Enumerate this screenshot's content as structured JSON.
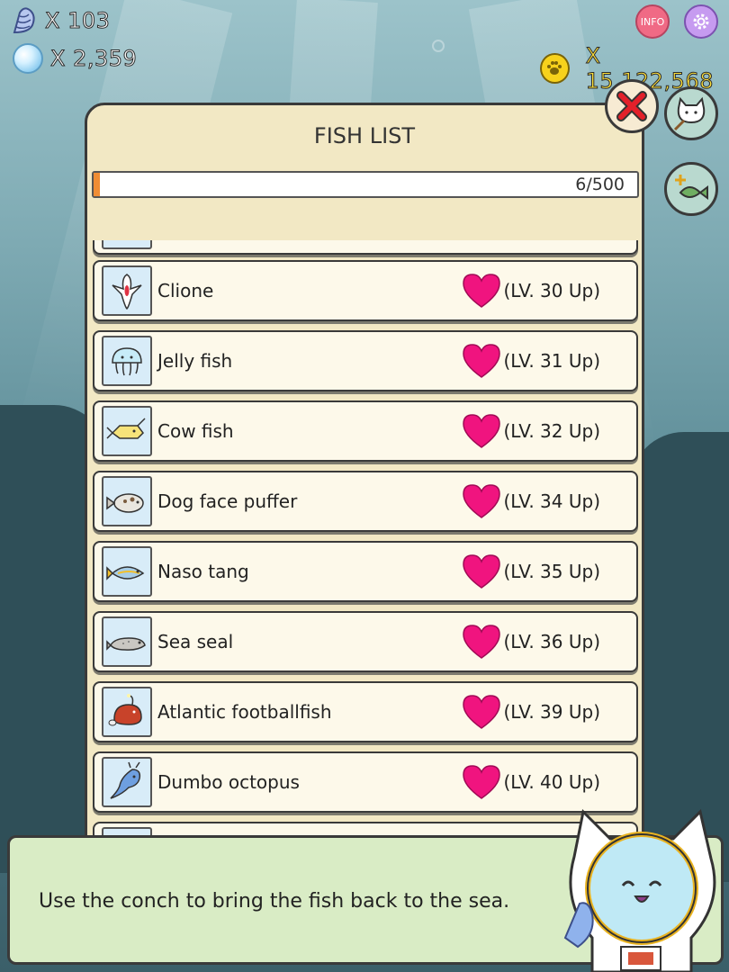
{
  "hud": {
    "conch_count": "X 103",
    "pearl_count": "X 2,359",
    "coin_count": "X 15,122,568",
    "info_label": "INFO"
  },
  "panel": {
    "title": "FISH LIST",
    "progress_label": "6/500",
    "progress_fraction": 0.012
  },
  "fish": [
    {
      "name": "Clione",
      "level": "(LV. 30 Up)",
      "icon": "clione-icon"
    },
    {
      "name": "Jelly fish",
      "level": "(LV. 31 Up)",
      "icon": "jellyfish-icon"
    },
    {
      "name": "Cow fish",
      "level": "(LV. 32 Up)",
      "icon": "cowfish-icon"
    },
    {
      "name": "Dog face puffer",
      "level": "(LV. 34 Up)",
      "icon": "puffer-icon"
    },
    {
      "name": "Naso tang",
      "level": "(LV. 35 Up)",
      "icon": "naso-tang-icon"
    },
    {
      "name": "Sea seal",
      "level": "(LV. 36 Up)",
      "icon": "seal-icon"
    },
    {
      "name": "Atlantic footballfish",
      "level": "(LV. 39 Up)",
      "icon": "footballfish-icon"
    },
    {
      "name": "Dumbo octopus",
      "level": "(LV. 40 Up)",
      "icon": "octopus-icon"
    }
  ],
  "tip": {
    "text": "Use the conch to bring the fish back to the sea."
  },
  "colors": {
    "heart": "#f0147f",
    "panel": "#f2e8c4",
    "tip_bar": "#d9ecc5",
    "coin_text": "#ffe23a"
  }
}
